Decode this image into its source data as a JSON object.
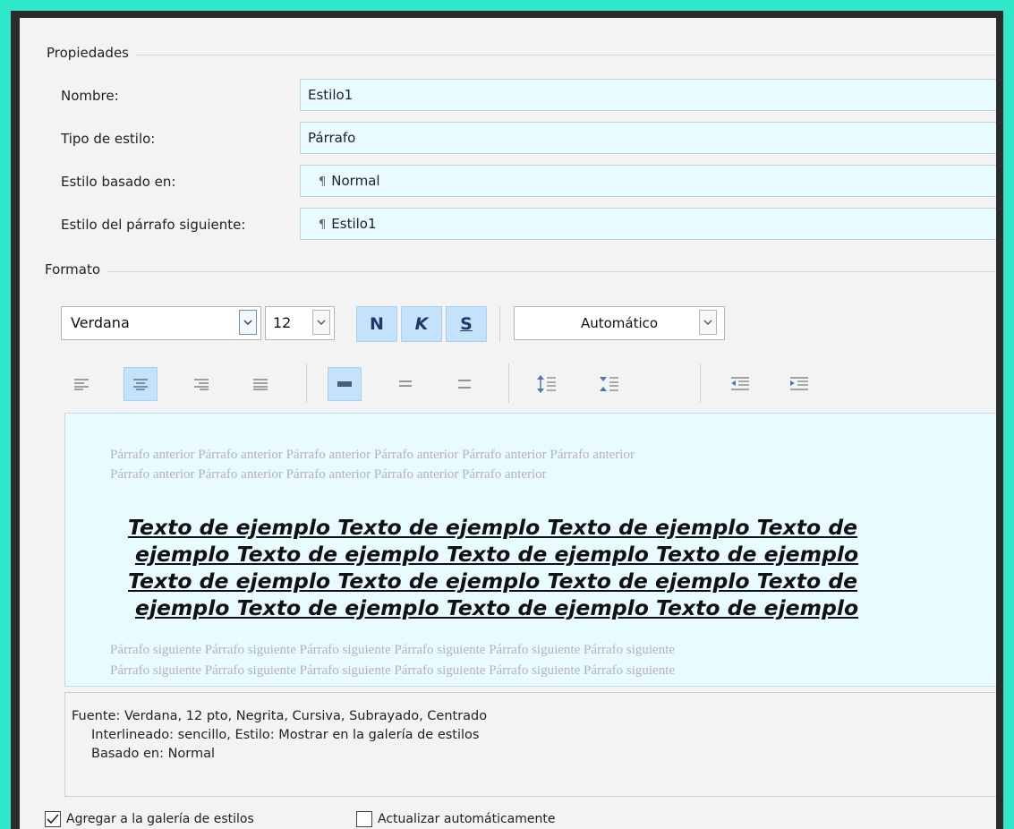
{
  "properties": {
    "group_label": "Propiedades",
    "name_label": "Nombre:",
    "name_value": "Estilo1",
    "type_label": "Tipo de estilo:",
    "type_value": "Párrafo",
    "based_label": "Estilo basado en:",
    "based_value": "Normal",
    "next_label": "Estilo del párrafo siguiente:",
    "next_value": "Estilo1"
  },
  "format": {
    "group_label": "Formato",
    "font_name": "Verdana",
    "font_size": "12",
    "bold_label": "N",
    "italic_label": "K",
    "underline_label": "S",
    "color_value": "Automático"
  },
  "toolbar": {
    "align": [
      "align-left-icon",
      "align-center-icon",
      "align-right-icon",
      "align-justify-icon"
    ],
    "spacing": [
      "line-spacing-single-icon",
      "line-spacing-1-5-icon",
      "line-spacing-double-icon"
    ],
    "paragraph": [
      "space-before-increase-icon",
      "space-before-decrease-icon"
    ],
    "indent": [
      "decrease-indent-icon",
      "increase-indent-icon"
    ]
  },
  "preview": {
    "prev_line1": "Párrafo anterior Párrafo anterior Párrafo anterior Párrafo anterior Párrafo anterior Párrafo anterior",
    "prev_line2": "Párrafo anterior Párrafo anterior Párrafo anterior Párrafo anterior Párrafo anterior",
    "sample_line1": "Texto de ejemplo Texto de ejemplo Texto de ejemplo Texto de",
    "sample_line2": "ejemplo Texto de ejemplo Texto de ejemplo Texto de ejemplo",
    "sample_line3": "Texto de ejemplo Texto de ejemplo Texto de ejemplo Texto de",
    "sample_line4": "ejemplo Texto de ejemplo Texto de ejemplo Texto de ejemplo",
    "next_line1": "Párrafo siguiente Párrafo siguiente Párrafo siguiente Párrafo siguiente Párrafo siguiente Párrafo siguiente",
    "next_line2": "Párrafo siguiente Párrafo siguiente Párrafo siguiente Párrafo siguiente Párrafo siguiente Párrafo siguiente"
  },
  "description": {
    "line1": "Fuente: Verdana, 12 pto, Negrita, Cursiva, Subrayado, Centrado",
    "line2": "Interlineado:  sencillo, Estilo: Mostrar en la galería de estilos",
    "line3": "Basado en: Normal"
  },
  "options": {
    "add_gallery_label": "Agregar a la galería de estilos",
    "add_gallery_checked": true,
    "auto_update_label": "Actualizar automáticamente",
    "auto_update_checked": false
  },
  "colors": {
    "frame": "#2ee8c8",
    "field_bg": "#e8fbff",
    "toggle_active": "#c4e3fb"
  }
}
